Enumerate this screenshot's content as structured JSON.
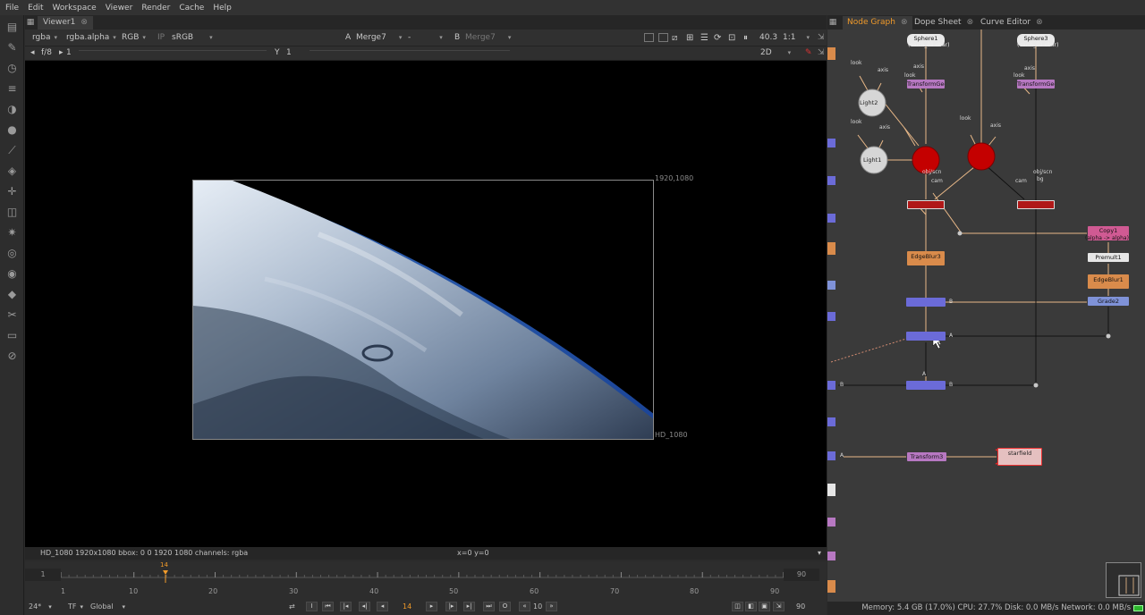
{
  "menu": [
    "File",
    "Edit",
    "Workspace",
    "Viewer",
    "Render",
    "Cache",
    "Help"
  ],
  "viewer": {
    "tab_label": "Viewer1",
    "channels": "rgba",
    "alpha": "rgba.alpha",
    "display_channel": "RGB",
    "ip_label": "IP",
    "colorspace": "sRGB",
    "a_label": "A",
    "a_input": "Merge7",
    "dash": "-",
    "b_label": "B",
    "b_input": "Merge7",
    "zoom": "40.3",
    "ratio": "1:1",
    "fstop": "f/8",
    "gain": "1",
    "y_label": "Y",
    "gamma": "1",
    "view_mode": "2D",
    "format_tr": "1920,1080",
    "format_br": "HD_1080",
    "info": "HD_1080 1920x1080  bbox: 0 0 1920 1080 channels: rgba",
    "coords": "x=0 y=0"
  },
  "timeline": {
    "start": "1",
    "end": "90",
    "current": "14",
    "ticks": [
      "1",
      "10",
      "20",
      "30",
      "40",
      "50",
      "60",
      "70",
      "80",
      "90"
    ],
    "fps": "24*",
    "tf": "TF",
    "scope": "Global",
    "current_frame": "14",
    "step": "10",
    "end_frame": "90"
  },
  "node_graph": {
    "tabs": [
      "Node Graph",
      "Dope Sheet",
      "Curve Editor"
    ],
    "nodes": {
      "sphere1": "Sphere1",
      "sphere1_sub": "(earth_01.cbar)",
      "sphere3": "Sphere3",
      "sphere3_sub": "(earth_01.cbar)",
      "light2": "Light2",
      "light1": "Light1",
      "transform_geo1": "TransformGeo",
      "transform_geo2": "TransformGeo",
      "edgeblur3": "EdgeBlur3",
      "edgeblur1": "EdgeBlur1",
      "copy1": "Copy1",
      "copy1_sub": "(alpha -> alpha)",
      "premult1": "Premult1",
      "grade2": "Grade2",
      "transform3": "Transform3",
      "starfield": "starfield"
    },
    "labels": {
      "look": "look",
      "axis": "axis",
      "obj_scn": "obj/scn",
      "cam": "cam",
      "bg": "bg",
      "a": "A",
      "b": "B"
    }
  },
  "status": {
    "text": "Memory: 5.4 GB (17.0%) CPU: 27.7% Disk: 0.0 MB/s Network: 0.0 MB/s"
  },
  "colors": {
    "accent": "#f09a2a",
    "transform_node": "#b778c2",
    "merge_node": "#6b6bd8",
    "edgeblur_node": "#d98b4b",
    "scanline_node": "#b01818",
    "camera_node": "#c00000",
    "copy_node": "#d05a93"
  }
}
